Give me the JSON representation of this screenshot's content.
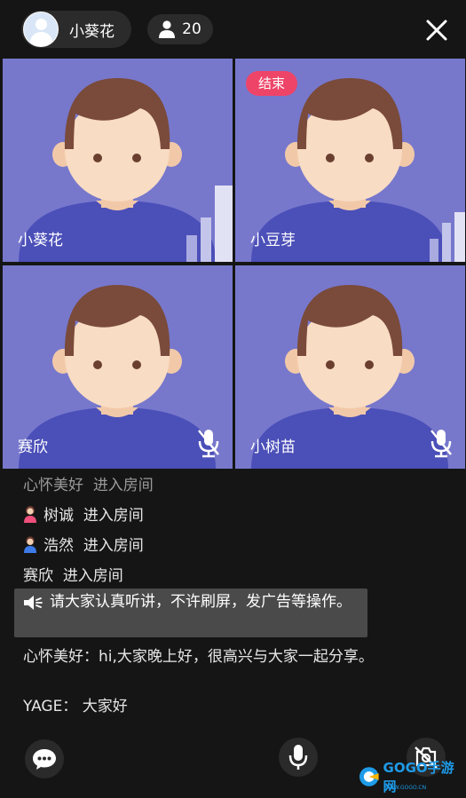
{
  "header": {
    "host_name": "小葵花",
    "viewer_count": "20",
    "icons": {
      "avatar": "avatar-icon",
      "count": "person-icon",
      "close": "close-icon"
    }
  },
  "tiles": [
    {
      "name": "小葵花",
      "badge": "",
      "volume_bars": true,
      "muted": false
    },
    {
      "name": "小豆芽",
      "badge": "结束",
      "volume_bars": true,
      "muted": false
    },
    {
      "name": "赛欣",
      "badge": "",
      "volume_bars": false,
      "muted": true
    },
    {
      "name": "小树苗",
      "badge": "",
      "volume_bars": false,
      "muted": true
    }
  ],
  "chat": {
    "messages": [
      {
        "user": "心怀美好",
        "text": "进入房间"
      },
      {
        "user": "树诚",
        "text": "进入房间",
        "icon": "female-user-icon"
      },
      {
        "user": "浩然",
        "text": "进入房间",
        "icon": "male-user-icon"
      },
      {
        "user": "赛欣",
        "text": "进入房间"
      }
    ],
    "announcement": "请大家认真听讲，不许刷屏，发广告等操作。",
    "greeting": "心怀美好：hi,大家晚上好，很高兴与大家一起分享。",
    "reply": "YAGE：  大家好"
  },
  "toolbar": {
    "icons": {
      "chat": "chat-bubble-icon",
      "mic": "microphone-icon",
      "camera": "camera-off-icon"
    }
  },
  "watermark": {
    "brand": "GOGO手游网",
    "url": "WWW.GOGO.CN"
  },
  "colors": {
    "tile_bg": "#7778cc",
    "badge": "#ee4468",
    "background": "#151515"
  }
}
